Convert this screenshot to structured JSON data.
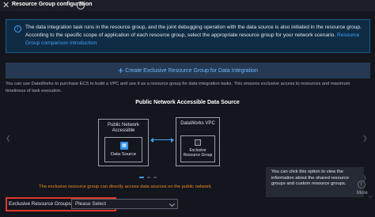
{
  "header": {
    "title": "Resource Group configuration",
    "help_icon": "?",
    "close_icon": "✕"
  },
  "info": {
    "icon": "i",
    "text": "The data integration task runs in the resource group, and the joint debugging operation with the data source is also initiated in the resource group. According to the specific scope of application of each resource group, select the appropriate resource group for your network scenario.",
    "link": "Resource Group comparison introduction"
  },
  "create_button": {
    "label": "Create Exclusive Resource Group for Data Integration"
  },
  "description": "You can use DataWorks to purchase ECS to build a VPC and use it as a resource group for data integration tasks. This ensures exclusive access to resources and maximum timeliness of task execution.",
  "carousel": {
    "title": "Public Network Accessible Data Source",
    "public_box": {
      "title": "Public Network Accessible",
      "inner_label": "Data Source"
    },
    "vpc_box": {
      "title": "DataWorks VPC",
      "inner_label": "Exclusive Resource Group"
    },
    "note": "The exclusive resource group can directly access data sources on the public network",
    "slides": 3,
    "active_slide": 0
  },
  "tooltip": {
    "text": "You can click this option to view the information about the shared resource groups and custom resource groups."
  },
  "more": {
    "label": "More"
  },
  "selection": {
    "label": "Exclusive Resource Groups:",
    "value": "Please Select"
  },
  "colors": {
    "background": "#14161d",
    "accent": "#3ea1ff",
    "warning": "#f08a24",
    "highlight": "#e0362c"
  }
}
